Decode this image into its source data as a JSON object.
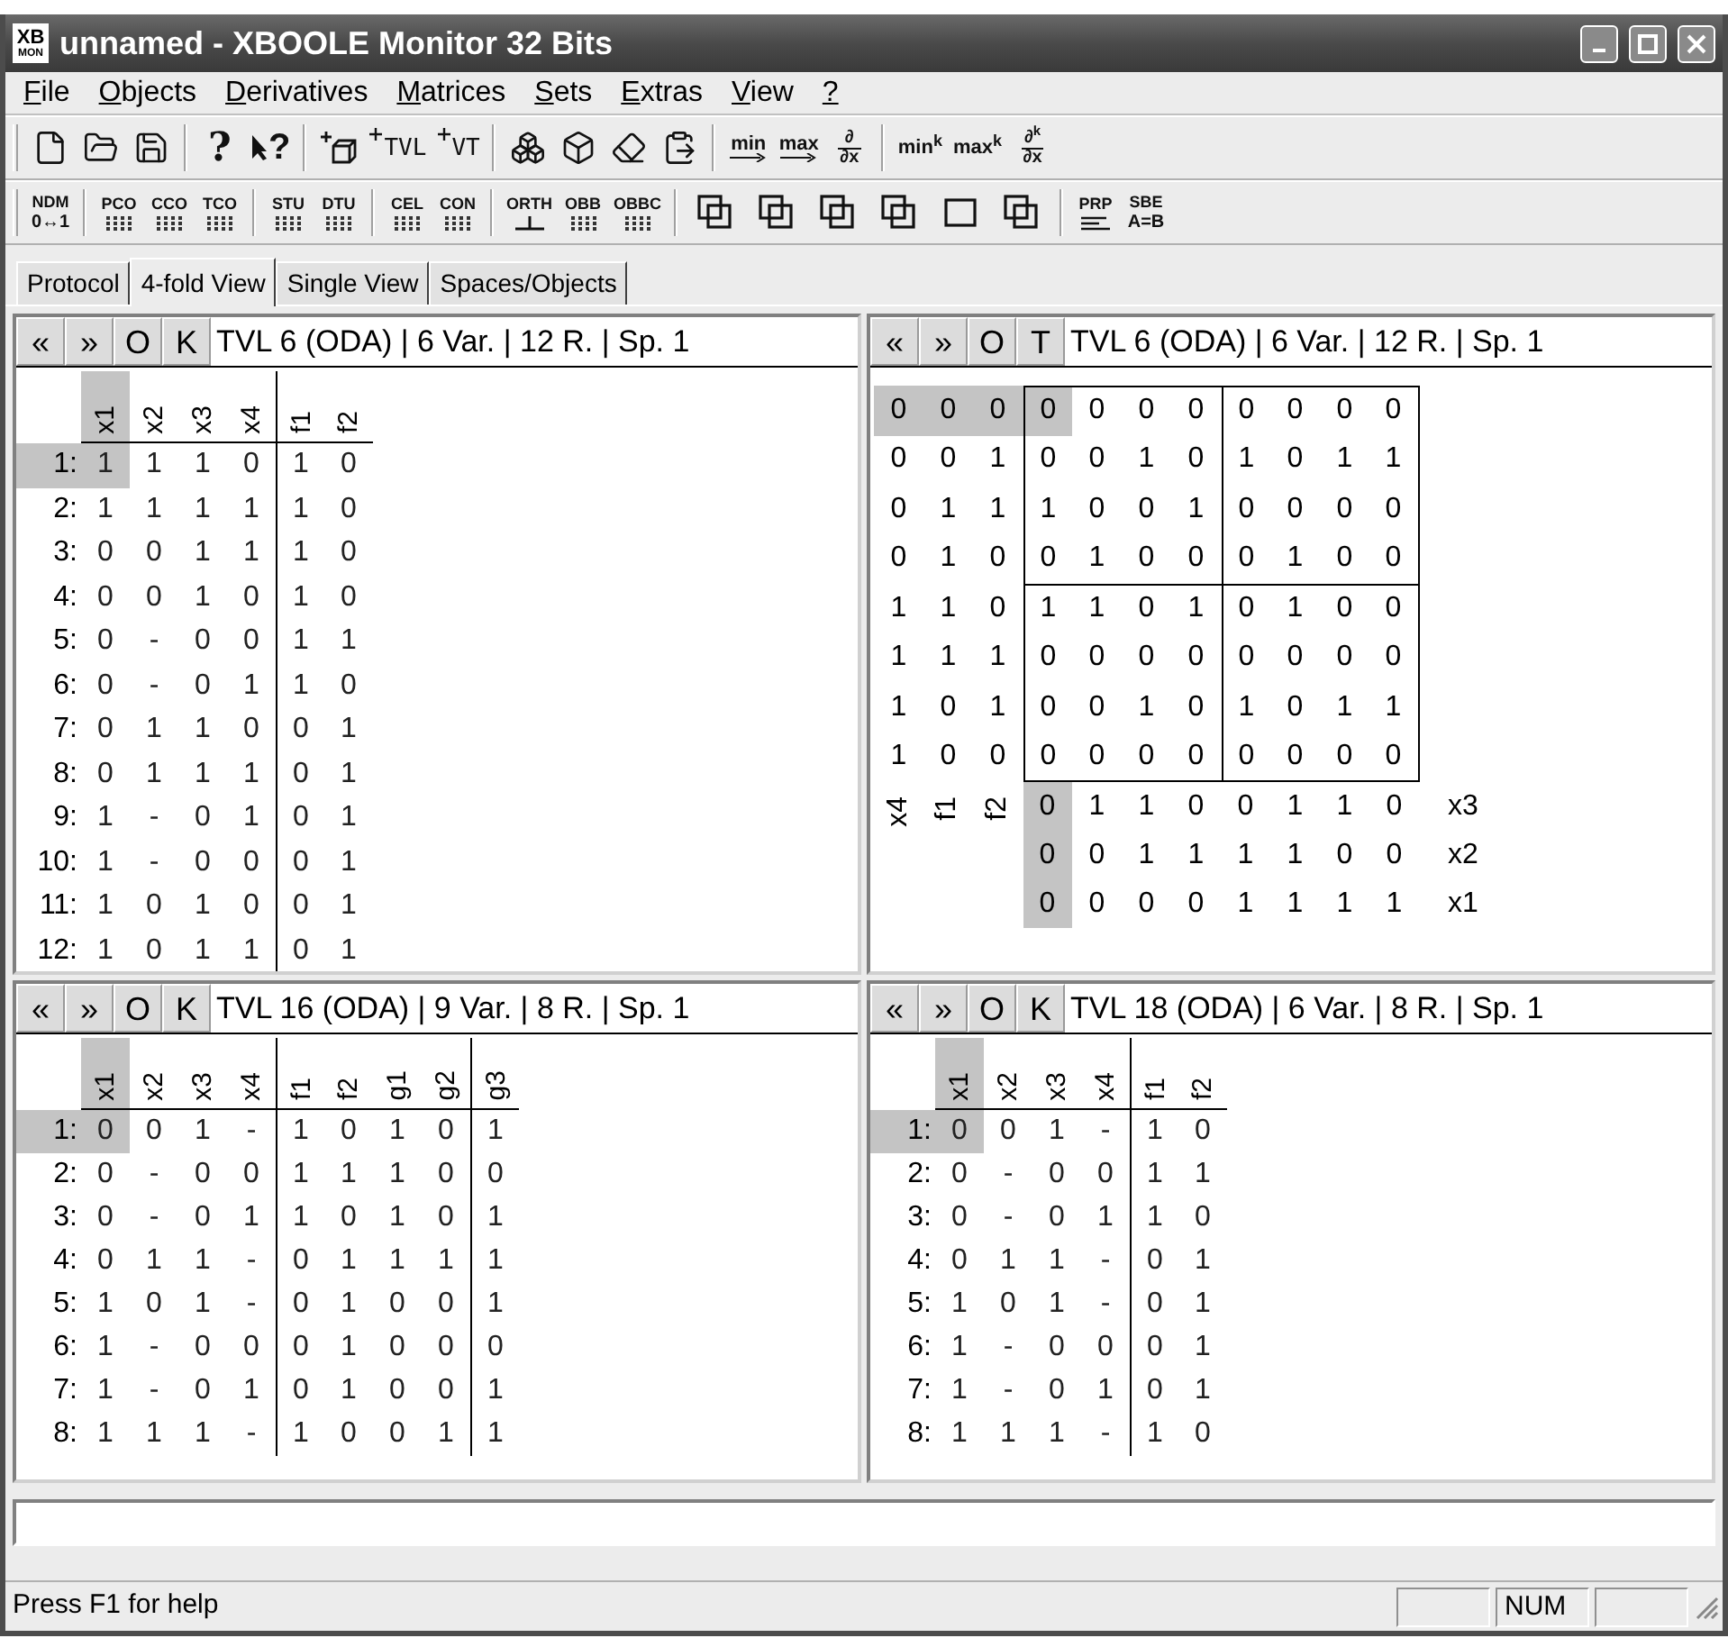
{
  "window": {
    "title": "unnamed - XBOOLE Monitor 32 Bits",
    "app_icon": {
      "top": "XB",
      "bottom": "MON"
    }
  },
  "menu": [
    "File",
    "Objects",
    "Derivatives",
    "Matrices",
    "Sets",
    "Extras",
    "View",
    "?"
  ],
  "toolbar_1": [
    [
      {
        "kind": "new"
      },
      {
        "kind": "open"
      },
      {
        "kind": "save"
      }
    ],
    [
      {
        "kind": "glyph",
        "text": "?"
      },
      {
        "kind": "pointer",
        "text": "?"
      }
    ],
    [
      {
        "kind": "newobject"
      },
      {
        "kind": "plus",
        "text": "TVL"
      },
      {
        "kind": "plus",
        "text": "VT"
      }
    ],
    [
      {
        "kind": "swap"
      },
      {
        "kind": "copyobject"
      },
      {
        "kind": "erase"
      },
      {
        "kind": "paste"
      }
    ],
    [
      {
        "kind": "arrow",
        "text": "min"
      },
      {
        "kind": "arrow",
        "text": "max"
      },
      {
        "kind": "fraction",
        "top": "∂",
        "bottom": "∂x"
      }
    ],
    [
      {
        "kind": "power",
        "text": "min",
        "sup": "k"
      },
      {
        "kind": "power",
        "text": "max",
        "sup": "k"
      },
      {
        "kind": "fraction",
        "top": "∂$^{k}$",
        "bottom": "∂x"
      }
    ]
  ],
  "toolbar_2": [
    [
      {
        "kind": "stack",
        "text": "NDM",
        "sub": "0↔1"
      }
    ],
    [
      {
        "kind": "dots",
        "text": "PCO"
      },
      {
        "kind": "dots",
        "text": "CCO"
      },
      {
        "kind": "dots",
        "text": "TCO"
      }
    ],
    [
      {
        "kind": "dots",
        "text": "STU"
      },
      {
        "kind": "dots",
        "text": "DTU"
      }
    ],
    [
      {
        "kind": "dots",
        "text": "CEL"
      },
      {
        "kind": "dots",
        "text": "CON"
      }
    ],
    [
      {
        "kind": "orth",
        "text": "ORTH"
      },
      {
        "kind": "dots",
        "text": "OBB"
      },
      {
        "kind": "dots",
        "text": "OBBC"
      }
    ],
    [
      {
        "kind": "window"
      },
      {
        "kind": "window"
      },
      {
        "kind": "window"
      },
      {
        "kind": "window"
      },
      {
        "kind": "square"
      },
      {
        "kind": "window"
      }
    ],
    [
      {
        "kind": "lines",
        "text": "PRP"
      },
      {
        "kind": "stack",
        "text": "SBE",
        "sub": "A=B"
      }
    ]
  ],
  "tabs": [
    {
      "label": "Protocol",
      "selected": false
    },
    {
      "label": "4-fold View",
      "selected": true
    },
    {
      "label": "Single View",
      "selected": false
    },
    {
      "label": "Spaces/Objects",
      "selected": false
    }
  ],
  "panels": [
    {
      "kind": "tvl",
      "buttons": [
        "«",
        "»",
        "O",
        "K"
      ],
      "title": "TVL 6 (ODA) | 6 Var. | 12 R. | Sp. 1",
      "groups": [
        [
          {
            "label": "x1",
            "selected": true
          },
          {
            "label": "x2",
            "selected": false
          },
          {
            "label": "x3",
            "selected": false
          },
          {
            "label": "x4",
            "selected": false
          }
        ],
        [
          {
            "label": "f1",
            "selected": false
          },
          {
            "label": "f2",
            "selected": false
          }
        ]
      ],
      "rows": [
        {
          "number": "1:",
          "selected": true,
          "cells": [
            "1",
            "1",
            "1",
            "0",
            "1",
            "0"
          ]
        },
        {
          "number": "2:",
          "selected": false,
          "cells": [
            "1",
            "1",
            "1",
            "1",
            "1",
            "0"
          ]
        },
        {
          "number": "3:",
          "selected": false,
          "cells": [
            "0",
            "0",
            "1",
            "1",
            "1",
            "0"
          ]
        },
        {
          "number": "4:",
          "selected": false,
          "cells": [
            "0",
            "0",
            "1",
            "0",
            "1",
            "0"
          ]
        },
        {
          "number": "5:",
          "selected": false,
          "cells": [
            "0",
            "-",
            "0",
            "0",
            "1",
            "1"
          ]
        },
        {
          "number": "6:",
          "selected": false,
          "cells": [
            "0",
            "-",
            "0",
            "1",
            "1",
            "0"
          ]
        },
        {
          "number": "7:",
          "selected": false,
          "cells": [
            "0",
            "1",
            "1",
            "0",
            "0",
            "1"
          ]
        },
        {
          "number": "8:",
          "selected": false,
          "cells": [
            "0",
            "1",
            "1",
            "1",
            "0",
            "1"
          ]
        },
        {
          "number": "9:",
          "selected": false,
          "cells": [
            "1",
            "-",
            "0",
            "1",
            "0",
            "1"
          ]
        },
        {
          "number": "10:",
          "selected": false,
          "cells": [
            "1",
            "-",
            "0",
            "0",
            "0",
            "1"
          ]
        },
        {
          "number": "11:",
          "selected": false,
          "cells": [
            "1",
            "0",
            "1",
            "0",
            "0",
            "1"
          ]
        },
        {
          "number": "12:",
          "selected": false,
          "cells": [
            "1",
            "0",
            "1",
            "1",
            "0",
            "1"
          ]
        }
      ]
    },
    {
      "kind": "kmap",
      "buttons": [
        "«",
        "»",
        "O",
        "T"
      ],
      "title": "TVL 6 (ODA) | 6 Var. | 12 R. | Sp. 1",
      "row_variables": [
        "x4",
        "f1",
        "f2"
      ],
      "column_variables": [
        "x3",
        "x2",
        "x1"
      ],
      "rows": [
        {
          "code": [
            "0",
            "0",
            "0"
          ],
          "selected": true,
          "cells": [
            "0",
            "0",
            "0",
            "0",
            "0",
            "0",
            "0",
            "0"
          ]
        },
        {
          "code": [
            "0",
            "0",
            "1"
          ],
          "selected": false,
          "cells": [
            "0",
            "0",
            "1",
            "0",
            "1",
            "0",
            "1",
            "1"
          ]
        },
        {
          "code": [
            "0",
            "1",
            "1"
          ],
          "selected": false,
          "cells": [
            "1",
            "0",
            "0",
            "1",
            "0",
            "0",
            "0",
            "0"
          ]
        },
        {
          "code": [
            "0",
            "1",
            "0"
          ],
          "selected": false,
          "cells": [
            "0",
            "1",
            "0",
            "0",
            "0",
            "1",
            "0",
            "0"
          ]
        },
        {
          "code": [
            "1",
            "1",
            "0"
          ],
          "selected": false,
          "cells": [
            "1",
            "1",
            "0",
            "1",
            "0",
            "1",
            "0",
            "0"
          ]
        },
        {
          "code": [
            "1",
            "1",
            "1"
          ],
          "selected": false,
          "cells": [
            "0",
            "0",
            "0",
            "0",
            "0",
            "0",
            "0",
            "0"
          ]
        },
        {
          "code": [
            "1",
            "0",
            "1"
          ],
          "selected": false,
          "cells": [
            "0",
            "0",
            "1",
            "0",
            "1",
            "0",
            "1",
            "1"
          ]
        },
        {
          "code": [
            "1",
            "0",
            "0"
          ],
          "selected": false,
          "cells": [
            "0",
            "0",
            "0",
            "0",
            "0",
            "0",
            "0",
            "0"
          ]
        }
      ],
      "column_keys": [
        {
          "code": [
            "0",
            "0",
            "0"
          ],
          "selected": true
        },
        {
          "code": [
            "1",
            "0",
            "0"
          ],
          "selected": false
        },
        {
          "code": [
            "1",
            "1",
            "0"
          ],
          "selected": false
        },
        {
          "code": [
            "0",
            "1",
            "0"
          ],
          "selected": false
        },
        {
          "code": [
            "0",
            "1",
            "1"
          ],
          "selected": false
        },
        {
          "code": [
            "1",
            "1",
            "1"
          ],
          "selected": false
        },
        {
          "code": [
            "1",
            "0",
            "1"
          ],
          "selected": false
        },
        {
          "code": [
            "0",
            "0",
            "1"
          ],
          "selected": false
        }
      ]
    },
    {
      "kind": "tvl",
      "buttons": [
        "«",
        "»",
        "O",
        "K"
      ],
      "title": "TVL 16 (ODA) | 9 Var. | 8 R. | Sp. 1",
      "groups": [
        [
          {
            "label": "x1",
            "selected": true
          },
          {
            "label": "x2",
            "selected": false
          },
          {
            "label": "x3",
            "selected": false
          },
          {
            "label": "x4",
            "selected": false
          }
        ],
        [
          {
            "label": "f1",
            "selected": false
          },
          {
            "label": "f2",
            "selected": false
          },
          {
            "label": "g1",
            "selected": false
          },
          {
            "label": "g2",
            "selected": false
          }
        ],
        [
          {
            "label": "g3",
            "selected": false
          }
        ]
      ],
      "rows": [
        {
          "number": "1:",
          "selected": true,
          "cells": [
            "0",
            "0",
            "1",
            "-",
            "1",
            "0",
            "1",
            "0",
            "1"
          ]
        },
        {
          "number": "2:",
          "selected": false,
          "cells": [
            "0",
            "-",
            "0",
            "0",
            "1",
            "1",
            "1",
            "0",
            "0"
          ]
        },
        {
          "number": "3:",
          "selected": false,
          "cells": [
            "0",
            "-",
            "0",
            "1",
            "1",
            "0",
            "1",
            "0",
            "1"
          ]
        },
        {
          "number": "4:",
          "selected": false,
          "cells": [
            "0",
            "1",
            "1",
            "-",
            "0",
            "1",
            "1",
            "1",
            "1"
          ]
        },
        {
          "number": "5:",
          "selected": false,
          "cells": [
            "1",
            "0",
            "1",
            "-",
            "0",
            "1",
            "0",
            "0",
            "1"
          ]
        },
        {
          "number": "6:",
          "selected": false,
          "cells": [
            "1",
            "-",
            "0",
            "0",
            "0",
            "1",
            "0",
            "0",
            "0"
          ]
        },
        {
          "number": "7:",
          "selected": false,
          "cells": [
            "1",
            "-",
            "0",
            "1",
            "0",
            "1",
            "0",
            "0",
            "1"
          ]
        },
        {
          "number": "8:",
          "selected": false,
          "cells": [
            "1",
            "1",
            "1",
            "-",
            "1",
            "0",
            "0",
            "1",
            "1"
          ]
        }
      ]
    },
    {
      "kind": "tvl",
      "buttons": [
        "«",
        "»",
        "O",
        "K"
      ],
      "title": "TVL 18 (ODA) | 6 Var. | 8 R. | Sp. 1",
      "groups": [
        [
          {
            "label": "x1",
            "selected": true
          },
          {
            "label": "x2",
            "selected": false
          },
          {
            "label": "x3",
            "selected": false
          },
          {
            "label": "x4",
            "selected": false
          }
        ],
        [
          {
            "label": "f1",
            "selected": false
          },
          {
            "label": "f2",
            "selected": false
          }
        ]
      ],
      "rows": [
        {
          "number": "1:",
          "selected": true,
          "cells": [
            "0",
            "0",
            "1",
            "-",
            "1",
            "0"
          ]
        },
        {
          "number": "2:",
          "selected": false,
          "cells": [
            "0",
            "-",
            "0",
            "0",
            "1",
            "1"
          ]
        },
        {
          "number": "3:",
          "selected": false,
          "cells": [
            "0",
            "-",
            "0",
            "1",
            "1",
            "0"
          ]
        },
        {
          "number": "4:",
          "selected": false,
          "cells": [
            "0",
            "1",
            "1",
            "-",
            "0",
            "1"
          ]
        },
        {
          "number": "5:",
          "selected": false,
          "cells": [
            "1",
            "0",
            "1",
            "-",
            "0",
            "1"
          ]
        },
        {
          "number": "6:",
          "selected": false,
          "cells": [
            "1",
            "-",
            "0",
            "0",
            "0",
            "1"
          ]
        },
        {
          "number": "7:",
          "selected": false,
          "cells": [
            "1",
            "-",
            "0",
            "1",
            "0",
            "1"
          ]
        },
        {
          "number": "8:",
          "selected": false,
          "cells": [
            "1",
            "1",
            "1",
            "-",
            "1",
            "0"
          ]
        }
      ]
    }
  ],
  "status_bar": {
    "text": "Press F1 for help",
    "indicators": [
      "NUM"
    ]
  }
}
